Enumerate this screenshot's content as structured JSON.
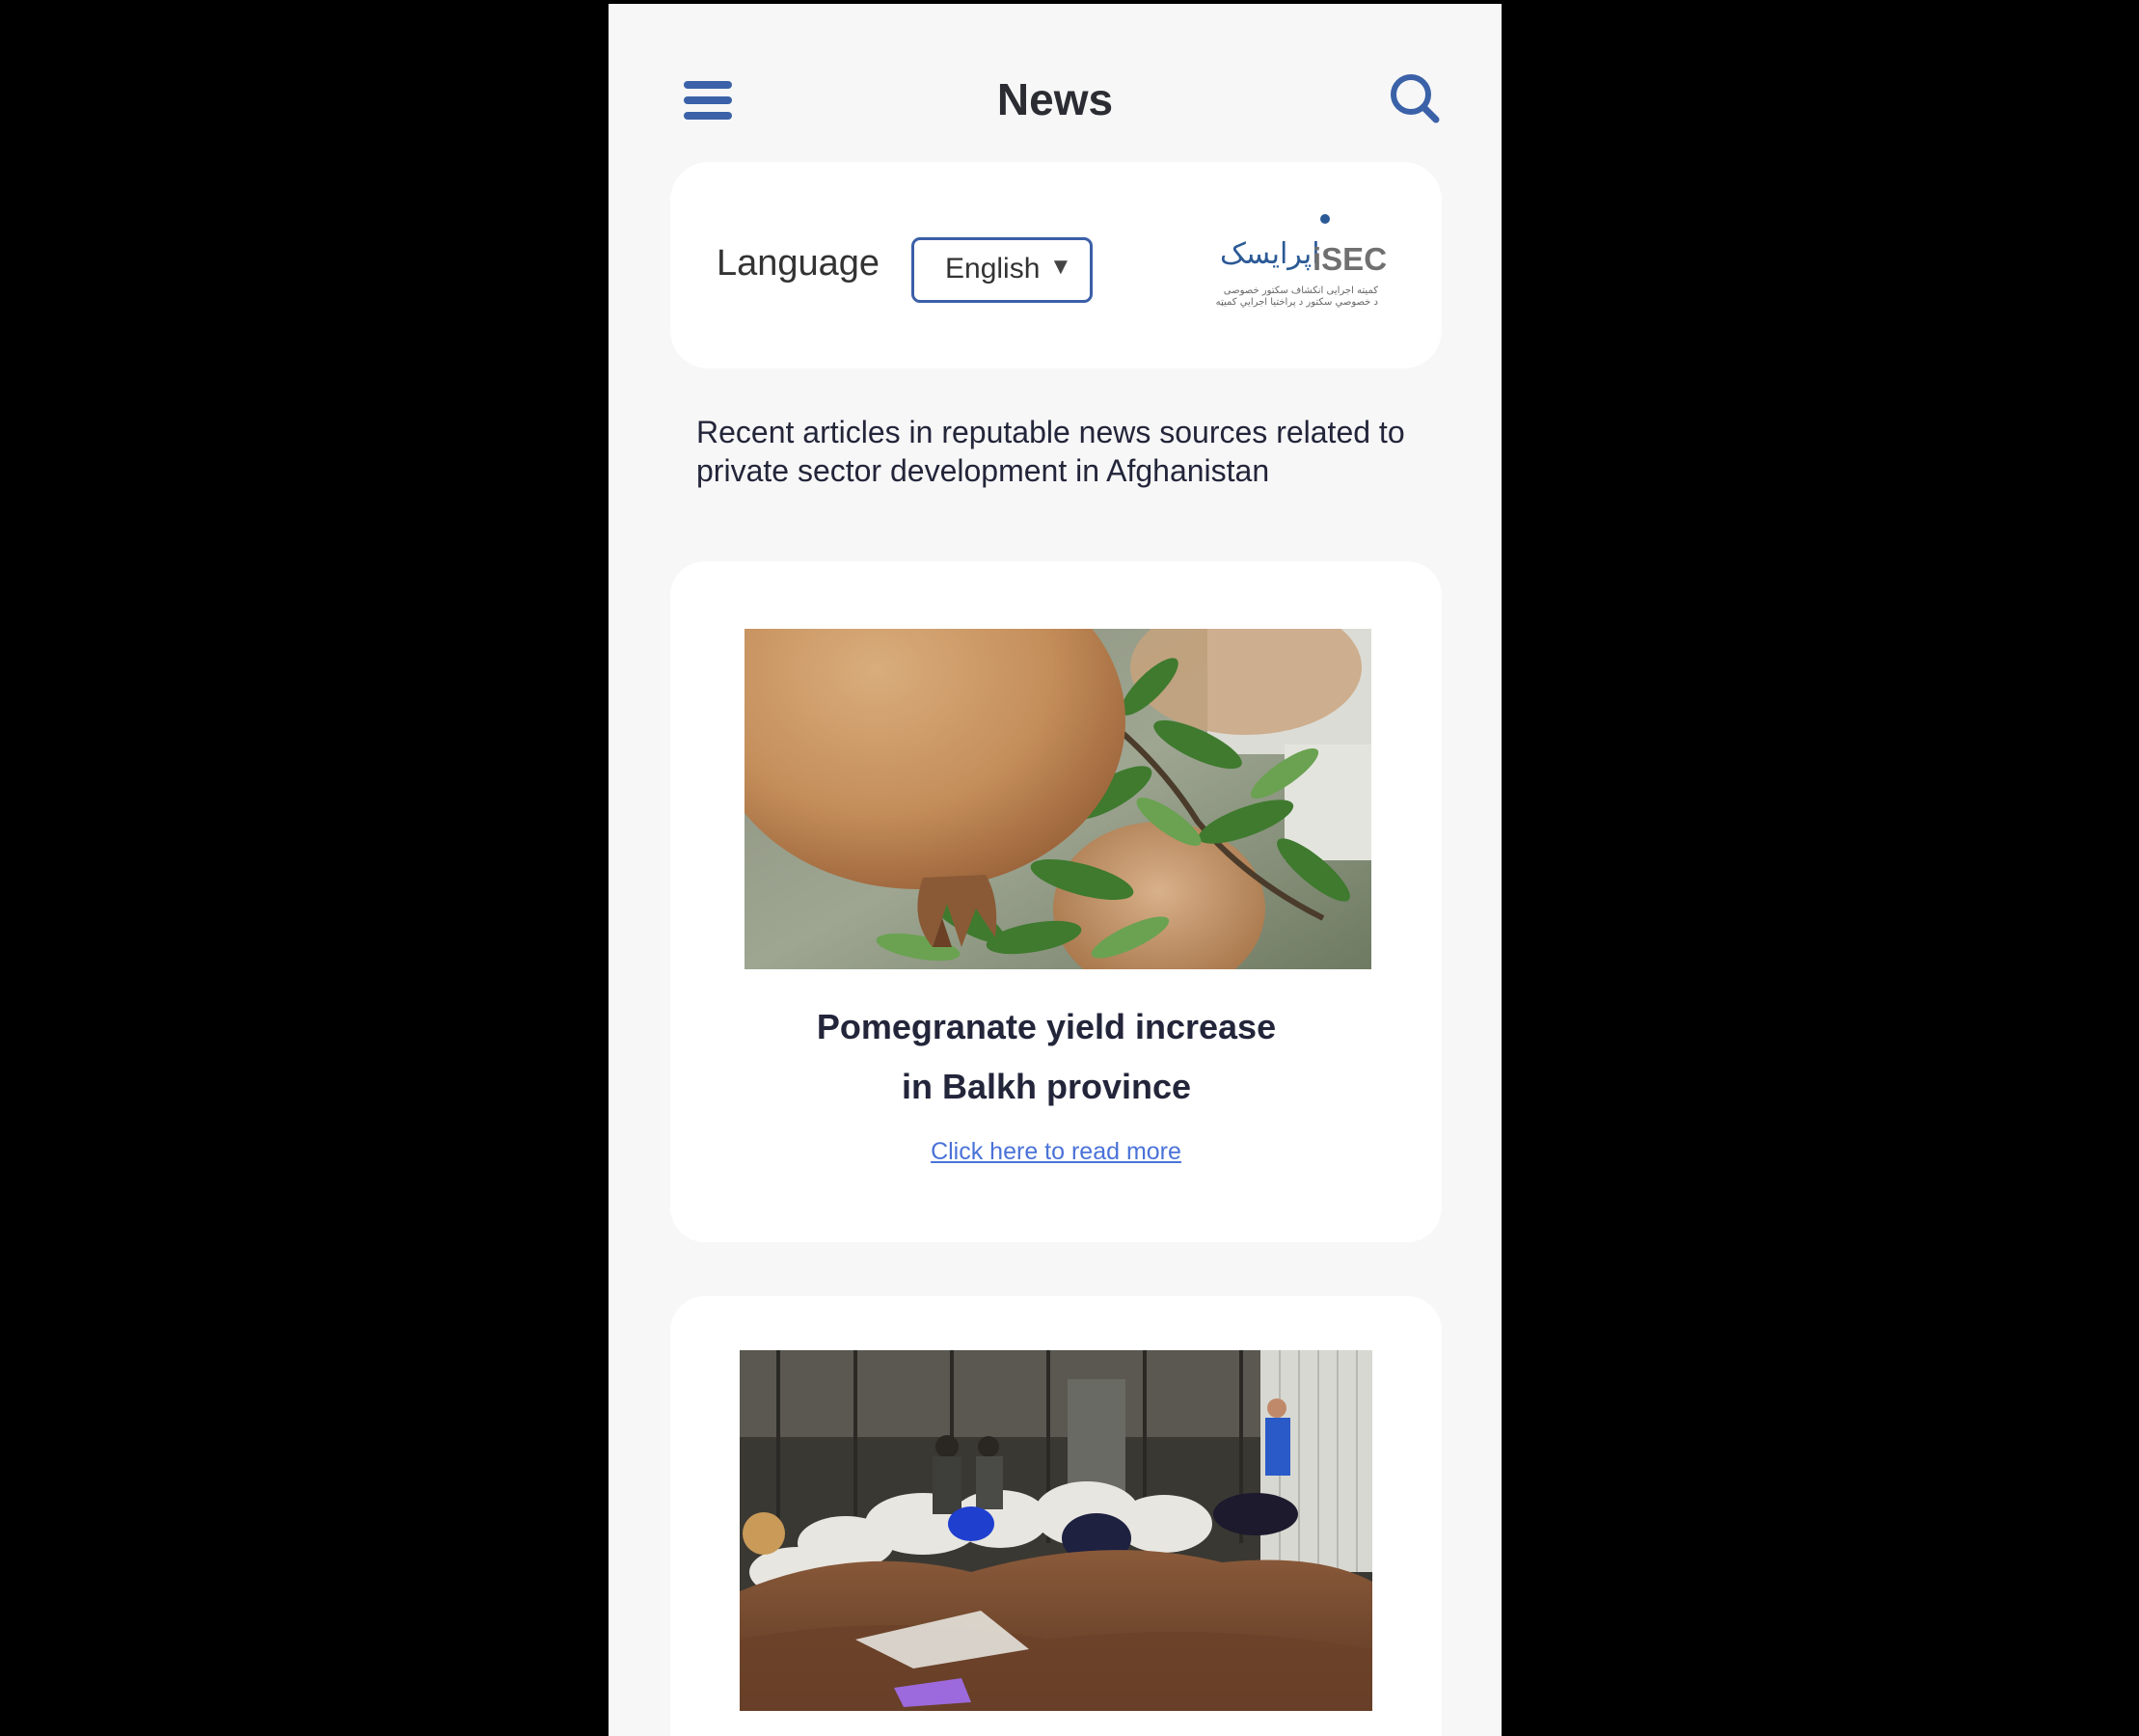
{
  "colors": {
    "accent": "#3b62a8",
    "title_text": "#2b2d33",
    "body_text": "#23253a",
    "link": "#4a72d8",
    "phone_bg": "#f7f7f7",
    "card_bg": "#ffffff",
    "outside_bg": "#000000"
  },
  "header": {
    "title": "News",
    "menu_icon": "hamburger-menu-icon",
    "search_icon": "search-icon"
  },
  "language_card": {
    "label": "Language",
    "selected_language": "English",
    "dropdown_icon": "triangle-down-icon"
  },
  "logo": {
    "text_en": "iSEC",
    "text_fa": "اپرایسک",
    "tagline_line1": "کمیته اجرایی انکشاف سکتور خصوصی",
    "tagline_line2": "د خصوصي سکتور د پراختیا اجرایي کمیټه"
  },
  "intro_text": "Recent articles in reputable news sources related to private sector development in Afghanistan",
  "articles": [
    {
      "title": "Pomegranate yield increase\nin Balkh province",
      "link_text": "Click here to read more"
    },
    {
      "title": "",
      "link_text": ""
    }
  ]
}
